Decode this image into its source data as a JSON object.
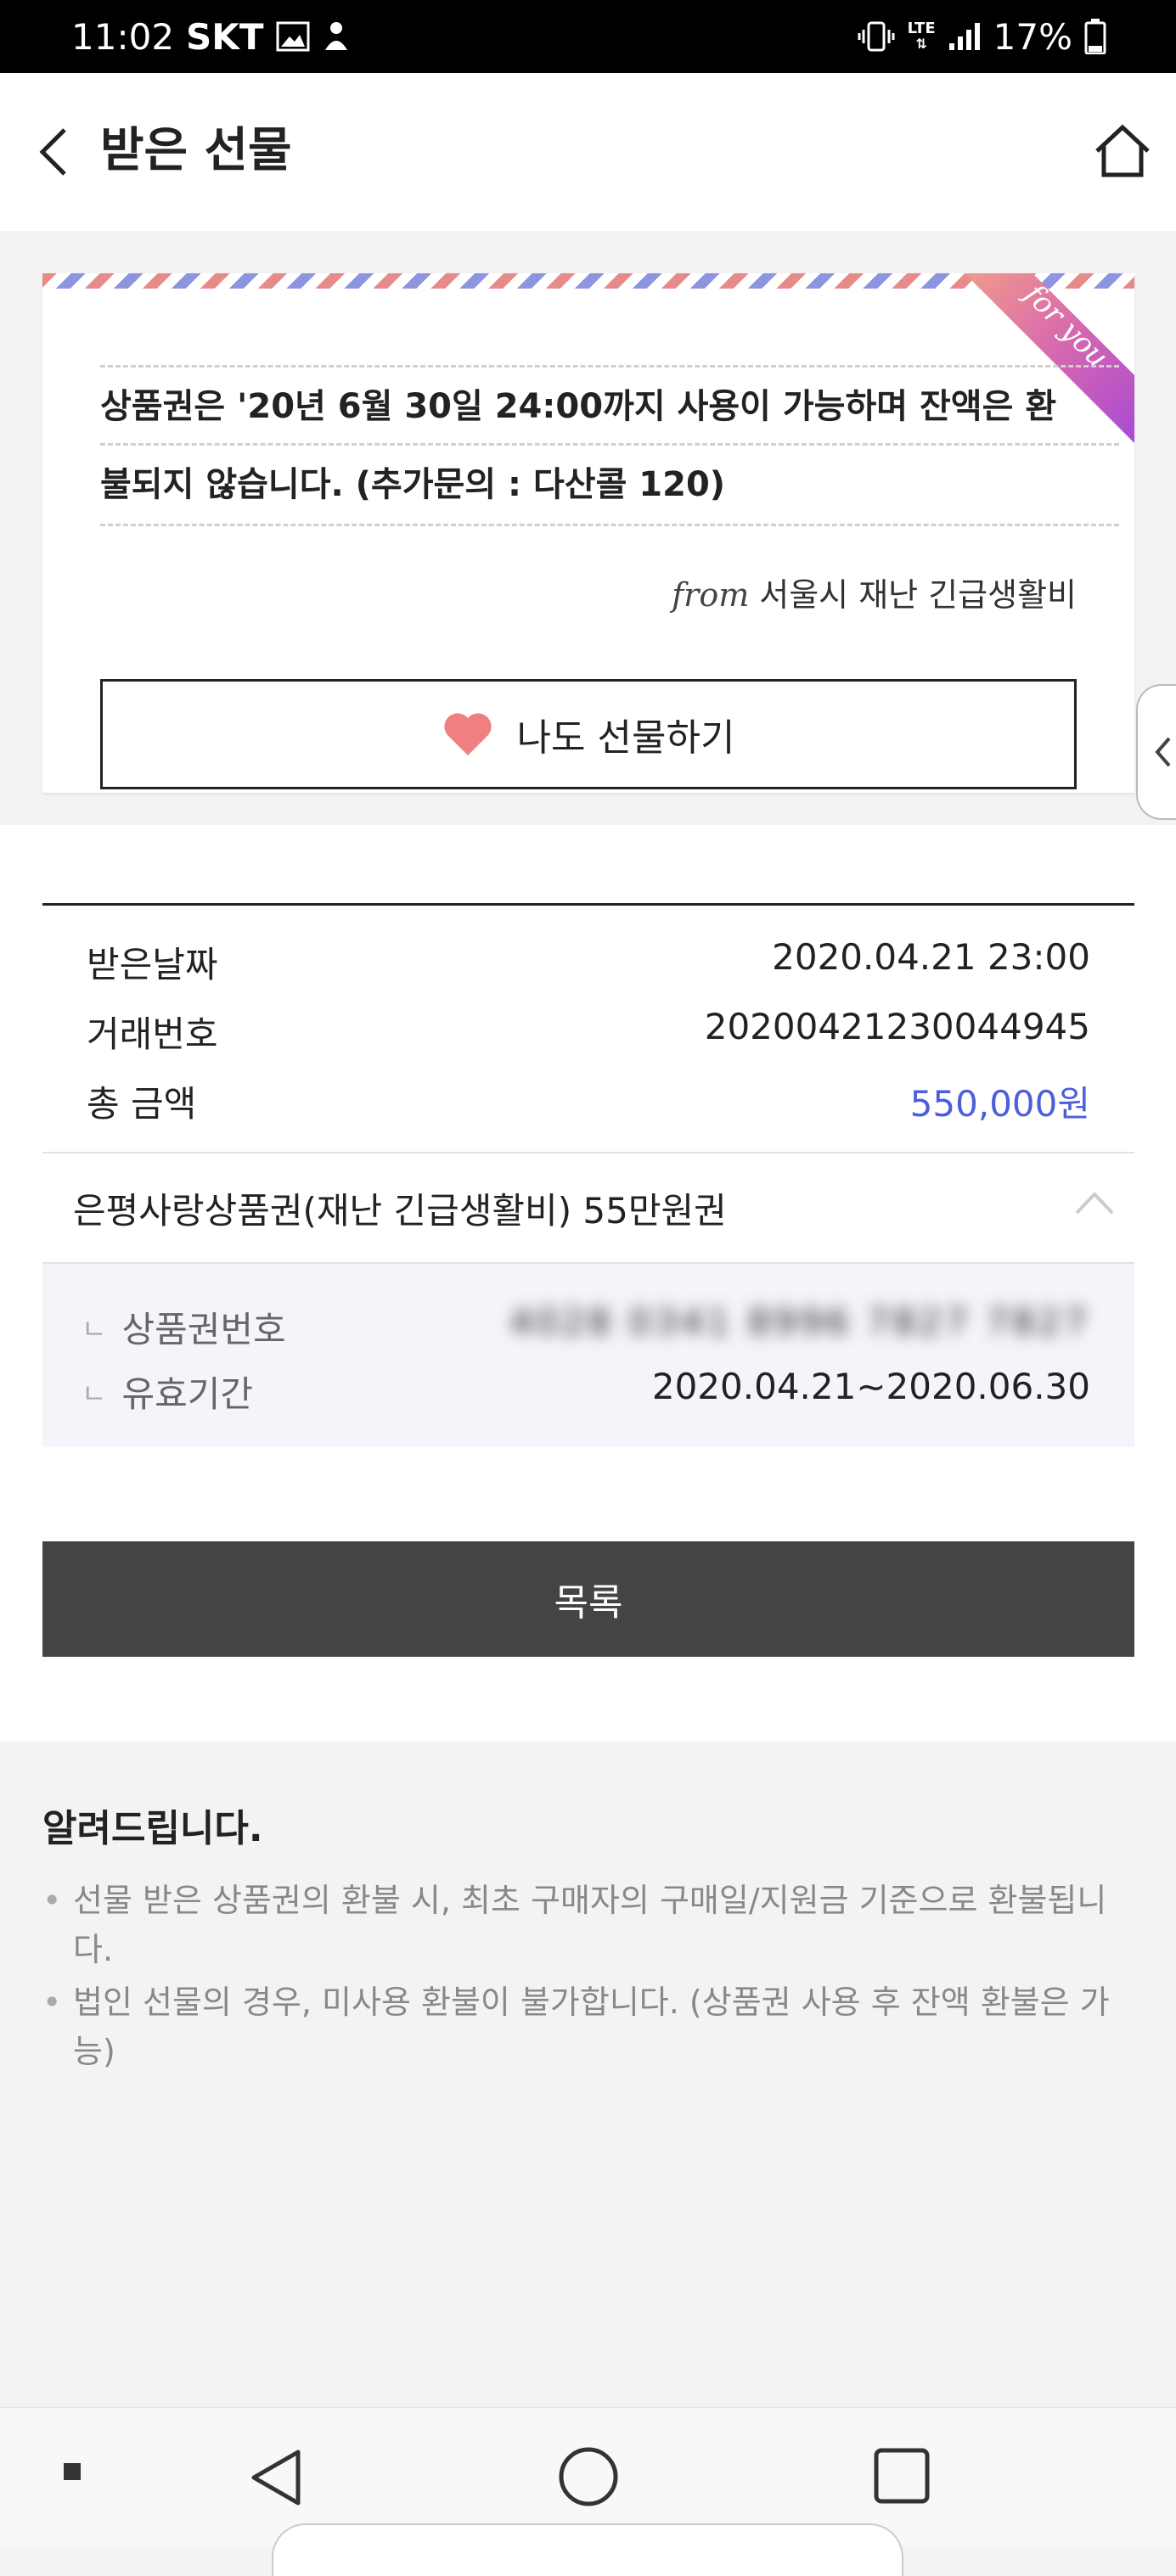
{
  "status_bar": {
    "time": "11:02",
    "carrier": "SKT",
    "network": "LTE",
    "battery": "17%"
  },
  "header": {
    "title": "받은 선물"
  },
  "gift_card": {
    "ribbon_text": "for you",
    "message_lines": [
      "상품권은 '20년 6월 30일 24:00까지 사용이 가능하며 잔액은 환",
      "불되지 않습니다. (추가문의 : 다산콜 120)"
    ],
    "from_label": "from",
    "from_sender": "서울시 재난 긴급생활비",
    "gift_button_label": "나도 선물하기"
  },
  "info": {
    "rows": [
      {
        "label": "받은날짜",
        "value": "2020.04.21 23:00"
      },
      {
        "label": "거래번호",
        "value": "20200421230044945"
      },
      {
        "label": "총 금액",
        "value": "550,000원"
      }
    ],
    "product_name": "은평사랑상품권(재난 긴급생활비) 55만원권",
    "details": [
      {
        "label": "상품권번호",
        "value": "4028 0341 8996 7827 7827"
      },
      {
        "label": "유효기간",
        "value": "2020.04.21~2020.06.30"
      }
    ],
    "list_button_label": "목록"
  },
  "notice": {
    "title": "알려드립니다.",
    "items": [
      "선물 받은 상품권의 환불 시, 최초 구매자의 구매일/지원금 기준으로 환불됩니다.",
      "법인 선물의 경우, 미사용 환불이 불가합니다. (상품권 사용 후 잔액 환불은 가능)"
    ]
  },
  "colors": {
    "amount": "#4b5fdc",
    "heart": "#f08080",
    "list_button_bg": "#444444"
  }
}
